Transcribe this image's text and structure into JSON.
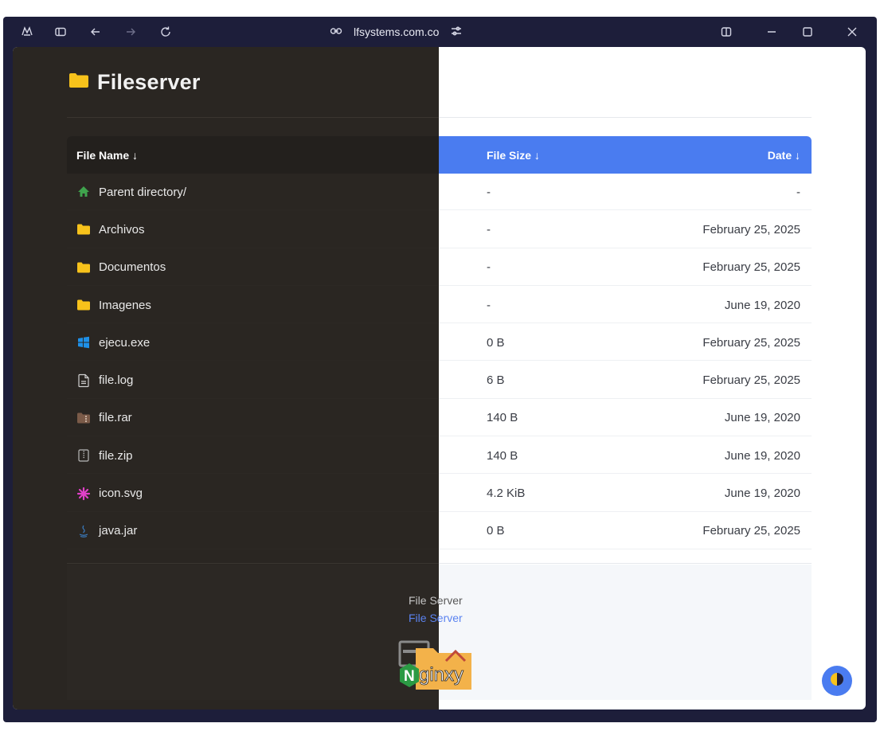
{
  "browser": {
    "url": "lfsystems.com.co"
  },
  "page": {
    "title": "Fileserver"
  },
  "table": {
    "headers": {
      "name": "File Name ↓",
      "size": "File Size ↓",
      "date": "Date ↓"
    },
    "rows": [
      {
        "name": "Parent directory/",
        "size": "-",
        "date": "-",
        "icon": "home-icon"
      },
      {
        "name": "Archivos",
        "size": "-",
        "date": "February 25, 2025",
        "icon": "folder-icon"
      },
      {
        "name": "Documentos",
        "size": "-",
        "date": "February 25, 2025",
        "icon": "folder-icon"
      },
      {
        "name": "Imagenes",
        "size": "-",
        "date": "June 19, 2020",
        "icon": "folder-icon"
      },
      {
        "name": "ejecu.exe",
        "size": "0 B",
        "date": "February 25, 2025",
        "icon": "windows-icon"
      },
      {
        "name": "file.log",
        "size": "6 B",
        "date": "February 25, 2025",
        "icon": "document-icon"
      },
      {
        "name": "file.rar",
        "size": "140 B",
        "date": "June 19, 2020",
        "icon": "archive-rar-icon"
      },
      {
        "name": "file.zip",
        "size": "140 B",
        "date": "June 19, 2020",
        "icon": "archive-zip-icon"
      },
      {
        "name": "icon.svg",
        "size": "4.2 KiB",
        "date": "June 19, 2020",
        "icon": "svg-icon"
      },
      {
        "name": "java.jar",
        "size": "0 B",
        "date": "February 25, 2025",
        "icon": "java-icon"
      }
    ]
  },
  "footer": {
    "line1": "File Server",
    "line2": "File Server",
    "logo_text": "Nginxy"
  },
  "colors": {
    "accent": "#4a7cf0",
    "folder": "#f7c21b",
    "dark_bg": "#2a2622"
  }
}
